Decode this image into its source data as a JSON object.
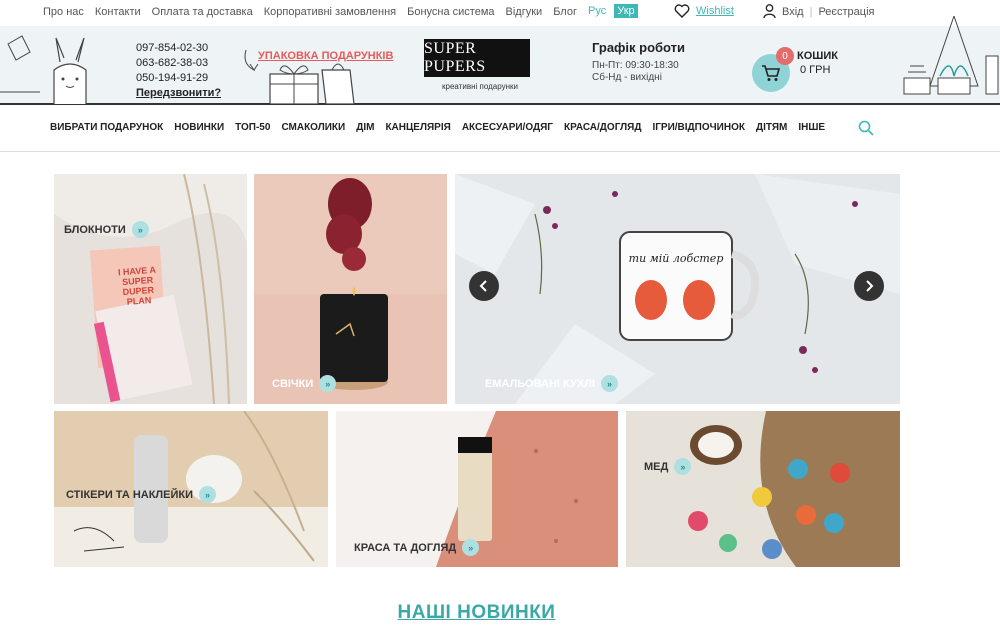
{
  "topbar": {
    "links": [
      "Про нас",
      "Контакти",
      "Оплата та доставка",
      "Корпоративні замовлення",
      "Бонусна система",
      "Відгуки",
      "Блог"
    ],
    "lang_ru": "Рус",
    "lang_ua": "Укр",
    "wishlist": "Wishlist",
    "login": "Вхід",
    "register": "Реєстрація"
  },
  "header": {
    "phones": [
      "097-854-02-30",
      "063-682-38-03",
      "050-194-91-29"
    ],
    "callback": "Передзвонити?",
    "gift_wrap": "УПАКОВКА ПОДАРУНКІВ",
    "logo": "SUPER PUPERS",
    "logo_sub": "креативні   подарунки",
    "schedule_title": "Графік роботи",
    "schedule_lines": [
      "Пн-Пт: 09:30-18:30",
      "Сб-Нд - вихідні"
    ],
    "cart_title": "КОШИК",
    "cart_sum": "0 ГРН",
    "cart_count": "0"
  },
  "nav": {
    "items": [
      "ВИБРАТИ ПОДАРУНОК",
      "НОВИНКИ",
      "ТОП-50",
      "СМАКОЛИКИ",
      "ДІМ",
      "КАНЦЕЛЯРІЯ",
      "АКСЕСУАРИ/ОДЯГ",
      "КРАСА/ДОГЛЯД",
      "ІГРИ/ВІДПОЧИНОК",
      "ДІТЯМ",
      "ІНШЕ"
    ]
  },
  "tiles": {
    "notebooks": "БЛОКНОТИ",
    "notebook_text": "I HAVE A SUPER DUPER PLAN",
    "candles": "СВІЧКИ",
    "mugs": "ЕМАЛЬОВАНІ КУХЛІ",
    "mug_text": "ти мій лобстер",
    "stickers": "СТІКЕРИ ТА НАКЛЕЙКИ",
    "beauty": "КРАСА ТА ДОГЛЯД",
    "honey": "МЕД"
  },
  "new_section": "НАШІ НОВИНКИ",
  "colors": {
    "accent": "#3fb7b5",
    "gift_link": "#e65b5b",
    "cart": "#8fd3d6"
  }
}
